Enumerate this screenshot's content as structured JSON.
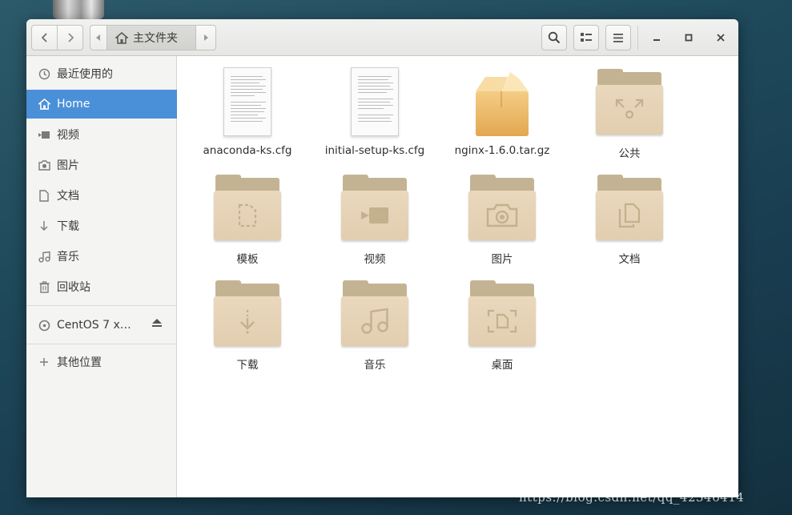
{
  "header": {
    "path": {
      "home_label": "主文件夹"
    }
  },
  "sidebar": {
    "items": [
      {
        "label": "最近使用的",
        "icon": "clock-icon"
      },
      {
        "label": "Home",
        "icon": "home-icon",
        "active": true
      },
      {
        "label": "视频",
        "icon": "video-icon"
      },
      {
        "label": "图片",
        "icon": "camera-icon"
      },
      {
        "label": "文档",
        "icon": "document-icon"
      },
      {
        "label": "下载",
        "icon": "download-icon"
      },
      {
        "label": "音乐",
        "icon": "music-icon"
      },
      {
        "label": "回收站",
        "icon": "trash-icon"
      }
    ],
    "devices": [
      {
        "label": "CentOS 7 x…",
        "icon": "disc-icon"
      }
    ],
    "other": {
      "label": "其他位置",
      "icon": "plus-icon"
    }
  },
  "files": [
    {
      "name": "anaconda-ks.cfg",
      "type": "text-file"
    },
    {
      "name": "initial-setup-ks.cfg",
      "type": "text-file"
    },
    {
      "name": "nginx-1.6.0.tar.gz",
      "type": "archive"
    },
    {
      "name": "公共",
      "type": "folder",
      "emblem": "share-icon"
    },
    {
      "name": "模板",
      "type": "folder",
      "emblem": "template-icon"
    },
    {
      "name": "视频",
      "type": "folder",
      "emblem": "video-icon"
    },
    {
      "name": "图片",
      "type": "folder",
      "emblem": "camera-icon"
    },
    {
      "name": "文档",
      "type": "folder",
      "emblem": "document-icon"
    },
    {
      "name": "下载",
      "type": "folder",
      "emblem": "download-icon"
    },
    {
      "name": "音乐",
      "type": "folder",
      "emblem": "music-icon"
    },
    {
      "name": "桌面",
      "type": "folder",
      "emblem": "desktop-icon"
    }
  ],
  "watermark": "https://blog.csdn.net/qq_42346414",
  "colors": {
    "accent": "#4a90d9",
    "folder_front": "#e6d3b6",
    "folder_back": "#c4b393",
    "sidebar_bg": "#f4f4f3"
  }
}
